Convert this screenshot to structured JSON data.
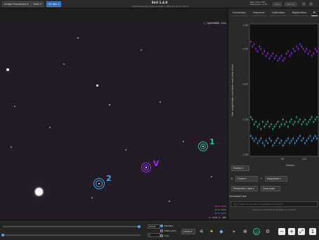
{
  "header": {
    "menu_image_processing": "Image Processing",
    "menu_tools": "Tools",
    "menu_scripts": "Scripts",
    "app_title": "Siril 1.4.0",
    "path": "...Data/Origin/XL_Cerebrum/dark_2025-12-29_21-46-11",
    "mem_line1": "Mem: 401.7 MiB",
    "mem_line2": "Disk Space: 1.2 TB",
    "save_label": "Save",
    "save_as_label": "Save as"
  },
  "image": {
    "filename": "r_light00002.fits",
    "labels": {
      "star1": "1",
      "star2": "2",
      "variable": "V"
    },
    "coords_line1": "R=14.0924",
    "coords_line2": "G=14.0434",
    "coords_line3": "B=14.0464",
    "pixel_readout": "x: 2119  y: 565"
  },
  "right_panel": {
    "tabs": [
      "Conversion",
      "Sequence",
      "Calibration",
      "Registration",
      "Pl"
    ],
    "display_select": "Display",
    "x_axis_select": "Frame",
    "y_axis_select": "Magnitude",
    "photometry_select": "Photometry data",
    "clear_plots": "Clear plots",
    "command_line_title": "Command line",
    "command_placeholder": "Type \"help\" for the list of supported commands",
    "status_message": "Sequence processing partially succeeded"
  },
  "chart_data": {
    "type": "scatter",
    "title": "",
    "ylabel": "Star magnitudes (variables and comp stars)",
    "xlabel": "Frames",
    "ylim": [
      -2.5,
      -1.95
    ],
    "ytick_labels": [
      "-1.95",
      "-2.05",
      "-2.20",
      "-2.35",
      "-2.50"
    ],
    "xtick_labels": [
      "90",
      "114"
    ],
    "series": [
      {
        "color": "#9b2cf0",
        "label": "V",
        "values": [
          -2.02,
          -2.04,
          -2.03,
          -2.05,
          -2.06,
          -2.04,
          -2.05,
          -2.07,
          -2.06,
          -2.08,
          -2.07,
          -2.09,
          -2.08,
          -2.07,
          -2.09,
          -2.08,
          -2.1,
          -2.09,
          -2.08,
          -2.1,
          -2.09,
          -2.07,
          -2.06,
          -2.08,
          -2.07,
          -2.05,
          -2.06,
          -2.04,
          -2.05,
          -2.03,
          -2.04,
          -2.05,
          -2.06,
          -2.05,
          -2.07,
          -2.06,
          -2.08,
          -2.07,
          -2.05,
          -2.06
        ]
      },
      {
        "color": "#2fbf94",
        "label": "1",
        "values": [
          -2.34,
          -2.35,
          -2.37,
          -2.36,
          -2.38,
          -2.37,
          -2.39,
          -2.36,
          -2.38,
          -2.37,
          -2.36,
          -2.38,
          -2.37,
          -2.39,
          -2.38,
          -2.37,
          -2.36,
          -2.38,
          -2.37,
          -2.35,
          -2.37,
          -2.36,
          -2.38,
          -2.36,
          -2.35,
          -2.37,
          -2.36,
          -2.34,
          -2.36,
          -2.35,
          -2.37,
          -2.36,
          -2.35,
          -2.37,
          -2.36,
          -2.35,
          -2.34,
          -2.36,
          -2.35,
          -2.34
        ]
      },
      {
        "color": "#4aa3e8",
        "label": "2",
        "values": [
          -2.42,
          -2.43,
          -2.44,
          -2.43,
          -2.45,
          -2.44,
          -2.43,
          -2.45,
          -2.46,
          -2.44,
          -2.45,
          -2.43,
          -2.44,
          -2.46,
          -2.45,
          -2.44,
          -2.43,
          -2.45,
          -2.44,
          -2.46,
          -2.45,
          -2.44,
          -2.43,
          -2.45,
          -2.44,
          -2.43,
          -2.45,
          -2.44,
          -2.43,
          -2.42,
          -2.44,
          -2.43,
          -2.45,
          -2.44,
          -2.43,
          -2.42,
          -2.44,
          -2.43,
          -2.42,
          -2.43
        ]
      }
    ]
  },
  "bottom": {
    "max_value": "65535",
    "min_value": "0",
    "mode_minmax": "Min/Max",
    "mode_mips": "MIPS-LO/HI",
    "mode_user": "User",
    "scale_select": "Linear"
  },
  "colors": {
    "accent": "#2e6db8",
    "star1": "#2fbf94",
    "star2": "#4aa3e8",
    "variable": "#9b2cf0"
  }
}
